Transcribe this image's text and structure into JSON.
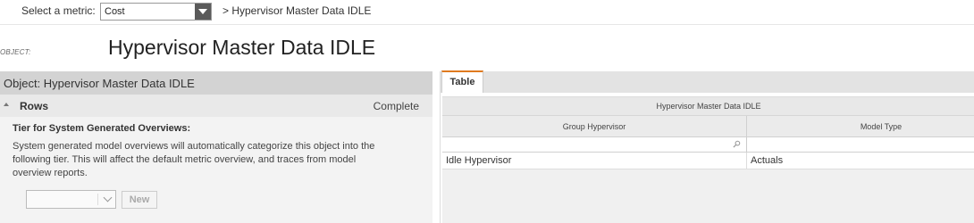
{
  "topbar": {
    "metric_label": "Select a metric:",
    "metric_value": "Cost",
    "breadcrumb": "> Hypervisor Master Data IDLE"
  },
  "object": {
    "label": "OBJECT:",
    "title": "Hypervisor Master Data IDLE"
  },
  "left_panel": {
    "header": "Object: Hypervisor Master Data IDLE",
    "rows_label": "Rows",
    "rows_status": "Complete",
    "tier_title": "Tier for System Generated Overviews:",
    "tier_description": "System generated model overviews will automatically categorize this object into the following tier. This will affect the default metric overview, and traces from model overview reports.",
    "tier_select_value": "",
    "new_button": "New"
  },
  "right_panel": {
    "tabs": [
      {
        "label": "Table",
        "active": true
      }
    ],
    "table_title": "Hypervisor Master Data IDLE",
    "columns": [
      "Group Hypervisor",
      "Model Type"
    ],
    "rows": [
      [
        "Idle Hypervisor",
        "Actuals"
      ]
    ]
  },
  "colors": {
    "accent_tab": "#e07a1f",
    "header_gray": "#d3d3d3"
  }
}
